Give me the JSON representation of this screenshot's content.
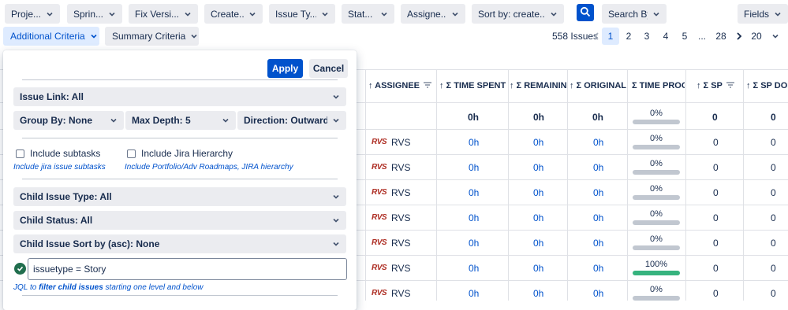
{
  "toolbar": {
    "filters": [
      "Proje...",
      "Sprin...",
      "Fix Versi...",
      "Create...",
      "Issue Ty...",
      "Stat...",
      "Assigne...",
      "Sort by: create..."
    ],
    "search_by": "Search By",
    "fields": "Fields"
  },
  "row2": {
    "additional_criteria": "Additional Criteria",
    "summary_criteria": "Summary Criteria",
    "issues_count": "558 Issues",
    "pages": [
      "1",
      "2",
      "3",
      "4",
      "5",
      "...",
      "28"
    ],
    "per_page": "20"
  },
  "table": {
    "headers": {
      "assignee": "↑ ASSIGNEE",
      "time_spent": "↑ Σ TIME SPENT",
      "remaining": "↑ Σ REMAININ...",
      "original": "↑ Σ ORIGINAL ...",
      "time_prog": "Σ TIME PROG",
      "sp": "↑ Σ SP",
      "sp_done": "↑ Σ SP DONE"
    },
    "summary": {
      "time_spent": "0h",
      "remaining": "0h",
      "original": "0h",
      "time_prog": "0%",
      "sp": "0",
      "sp_done": "0"
    },
    "rows": [
      {
        "avatar": "RVS",
        "assignee": "RVS",
        "time_spent": "0h",
        "remaining": "0h",
        "original": "0h",
        "time_prog": "0%",
        "progress": 0,
        "sp": "0",
        "sp_done": "0"
      },
      {
        "avatar": "RVS",
        "assignee": "RVS",
        "time_spent": "0h",
        "remaining": "0h",
        "original": "0h",
        "time_prog": "0%",
        "progress": 0,
        "sp": "0",
        "sp_done": "0"
      },
      {
        "avatar": "RVS",
        "assignee": "RVS",
        "time_spent": "0h",
        "remaining": "0h",
        "original": "0h",
        "time_prog": "0%",
        "progress": 0,
        "sp": "0",
        "sp_done": "0"
      },
      {
        "avatar": "RVS",
        "assignee": "RVS",
        "time_spent": "0h",
        "remaining": "0h",
        "original": "0h",
        "time_prog": "0%",
        "progress": 0,
        "sp": "0",
        "sp_done": "0"
      },
      {
        "avatar": "RVS",
        "assignee": "RVS",
        "time_spent": "0h",
        "remaining": "0h",
        "original": "0h",
        "time_prog": "0%",
        "progress": 0,
        "sp": "0",
        "sp_done": "0"
      },
      {
        "avatar": "RVS",
        "assignee": "RVS",
        "time_spent": "0h",
        "remaining": "0h",
        "original": "0h",
        "time_prog": "100%",
        "progress": 100,
        "sp": "0",
        "sp_done": "0"
      },
      {
        "avatar": "RVS",
        "assignee": "RVS",
        "time_spent": "0h",
        "remaining": "0h",
        "original": "0h",
        "time_prog": "0%",
        "progress": 0,
        "sp": "0",
        "sp_done": "0"
      }
    ]
  },
  "panel": {
    "apply": "Apply",
    "cancel": "Cancel",
    "issue_link": "Issue Link: All",
    "group_by": "Group By: None",
    "max_depth": "Max Depth: 5",
    "direction": "Direction: Outward",
    "include_subtasks": "Include subtasks",
    "include_subtasks_hint": "Include jira issue subtasks",
    "include_hierarchy": "Include Jira Hierarchy",
    "include_hierarchy_hint": "Include Portfolio/Adv Roadmaps, JIRA hierarchy",
    "child_issue_type": "Child Issue Type: All",
    "child_status": "Child Status: All",
    "child_sort": "Child Issue Sort by (asc): None",
    "jql_value": "issuetype = Story",
    "jql_hint_prefix": "JQL to ",
    "jql_hint_link": "filter child issues",
    "jql_hint_suffix": " starting one level and below"
  },
  "colors": {
    "accent": "#0052cc",
    "selected_bg": "#deebff",
    "progress_done": "#36b37e",
    "progress_empty": "#c1c7d0",
    "jql_valid": "#216e4e"
  }
}
